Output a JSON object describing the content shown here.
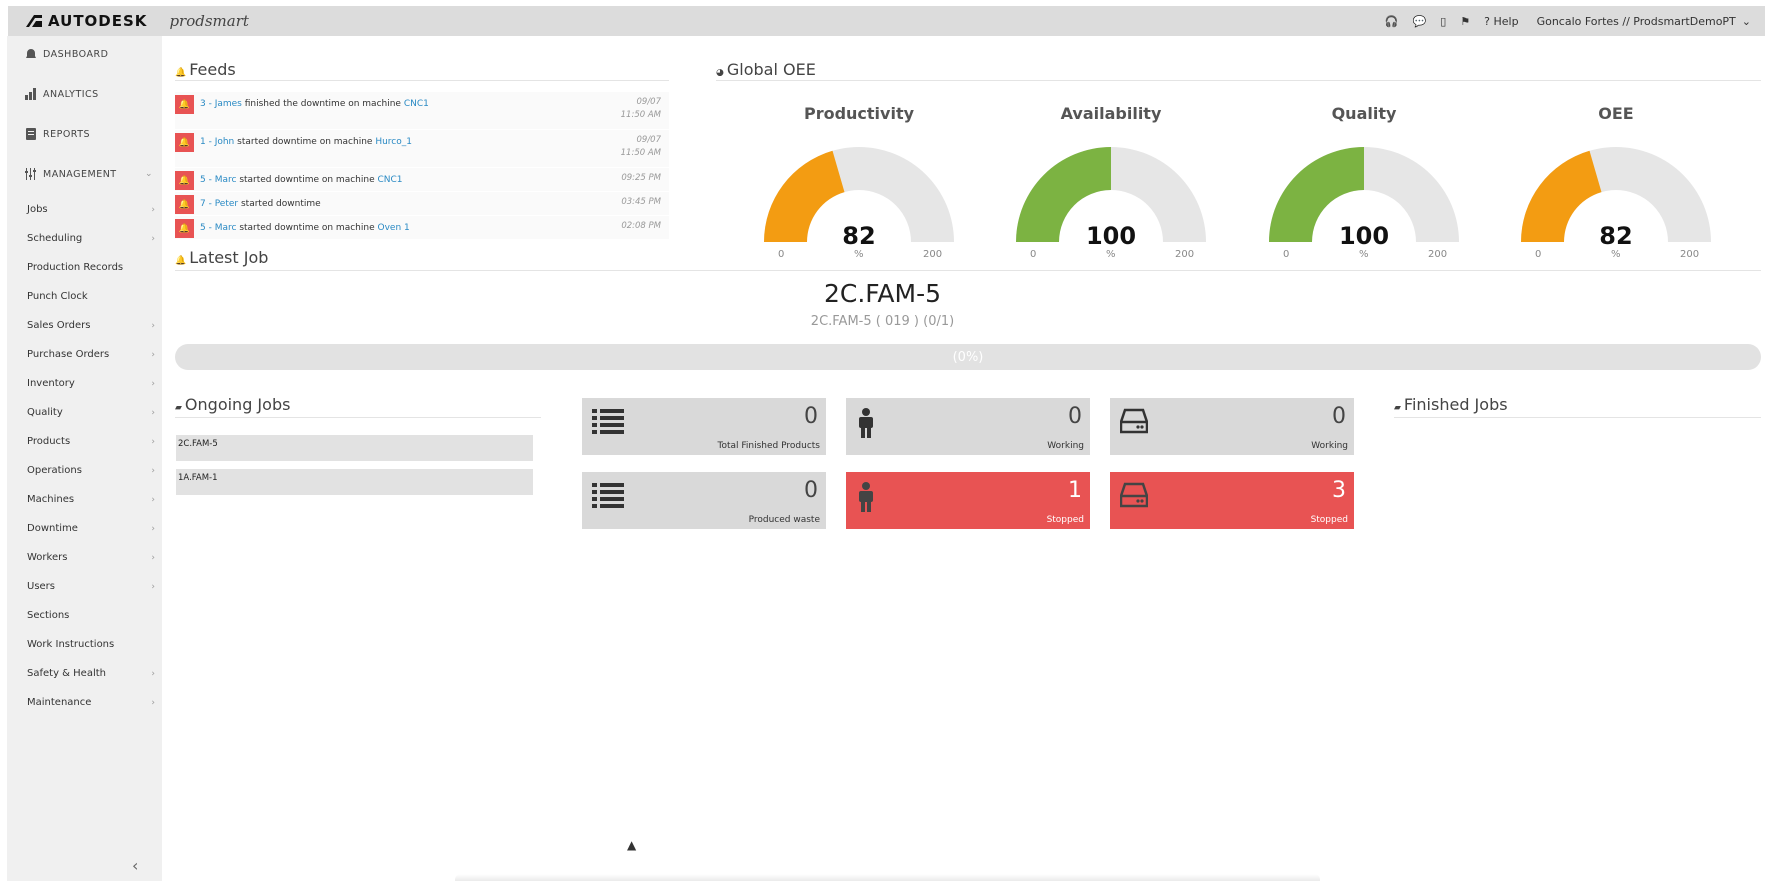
{
  "topbar": {
    "brand": "AUTODESK",
    "product": "prodsmart",
    "help": "Help",
    "user": "Goncalo Fortes // ProdsmartDemoPT"
  },
  "sidebar": {
    "top_items": [
      "DASHBOARD",
      "ANALYTICS",
      "REPORTS",
      "MANAGEMENT"
    ],
    "items": [
      {
        "label": "Jobs",
        "arrow": true
      },
      {
        "label": "Scheduling",
        "arrow": true
      },
      {
        "label": "Production Records",
        "arrow": false
      },
      {
        "label": "Punch Clock",
        "arrow": false
      },
      {
        "label": "Sales Orders",
        "arrow": true
      },
      {
        "label": "Purchase Orders",
        "arrow": true
      },
      {
        "label": "Inventory",
        "arrow": true
      },
      {
        "label": "Quality",
        "arrow": true
      },
      {
        "label": "Products",
        "arrow": true
      },
      {
        "label": "Operations",
        "arrow": true
      },
      {
        "label": "Machines",
        "arrow": true
      },
      {
        "label": "Downtime",
        "arrow": true
      },
      {
        "label": "Workers",
        "arrow": true
      },
      {
        "label": "Users",
        "arrow": true
      },
      {
        "label": "Sections",
        "arrow": false
      },
      {
        "label": "Work Instructions",
        "arrow": false
      },
      {
        "label": "Safety & Health",
        "arrow": true
      },
      {
        "label": "Maintenance",
        "arrow": true
      }
    ]
  },
  "feeds": {
    "title": "Feeds",
    "items": [
      {
        "worker": "3 - James",
        "action": "finished the downtime on machine",
        "machine": "CNC1",
        "date": "09/07",
        "time": "11:50 AM"
      },
      {
        "worker": "1 - John",
        "action": "started downtime on machine",
        "machine": "Hurco_1",
        "date": "09/07",
        "time": "11:50 AM"
      },
      {
        "worker": "5 - Marc",
        "action": "started downtime on machine",
        "machine": "CNC1",
        "date": "",
        "time": "09:25 PM"
      },
      {
        "worker": "7 - Peter",
        "action": "started downtime",
        "machine": "",
        "date": "",
        "time": "03:45 PM"
      },
      {
        "worker": "5 - Marc",
        "action": "started downtime on machine",
        "machine": "Oven 1",
        "date": "",
        "time": "02:08 PM"
      }
    ]
  },
  "global_oee": {
    "title": "Global OEE",
    "gauges": [
      {
        "label": "Productivity",
        "value": 82,
        "min": 0,
        "max": 200,
        "unit": "%",
        "color": "#f39c12"
      },
      {
        "label": "Availability",
        "value": 100,
        "min": 0,
        "max": 200,
        "unit": "%",
        "color": "#7cb342"
      },
      {
        "label": "Quality",
        "value": 100,
        "min": 0,
        "max": 200,
        "unit": "%",
        "color": "#7cb342"
      },
      {
        "label": "OEE",
        "value": 82,
        "min": 0,
        "max": 200,
        "unit": "%",
        "color": "#f39c12"
      }
    ]
  },
  "latest_job": {
    "title": "Latest Job",
    "name": "2C.FAM-5",
    "subtitle": "2C.FAM-5 ( 019 ) (0/1)",
    "progress_label": "(0%)",
    "progress": 0
  },
  "ongoing_jobs": {
    "title": "Ongoing Jobs",
    "items": [
      "2C.FAM-5",
      "1A.FAM-1"
    ]
  },
  "stats": [
    {
      "icon": "list-icon",
      "value": "0",
      "label": "Total Finished Products",
      "color": "#d9d9d9"
    },
    {
      "icon": "person-icon",
      "value": "0",
      "label": "Working",
      "color": "#d9d9d9"
    },
    {
      "icon": "machine-icon",
      "value": "0",
      "label": "Working",
      "color": "#d9d9d9"
    },
    {
      "icon": "list-icon",
      "value": "0",
      "label": "Produced waste",
      "color": "#d9d9d9"
    },
    {
      "icon": "person-icon",
      "value": "1",
      "label": "Stopped",
      "color": "#e85353"
    },
    {
      "icon": "machine-icon",
      "value": "3",
      "label": "Stopped",
      "color": "#e85353"
    }
  ],
  "finished_jobs": {
    "title": "Finished Jobs"
  }
}
